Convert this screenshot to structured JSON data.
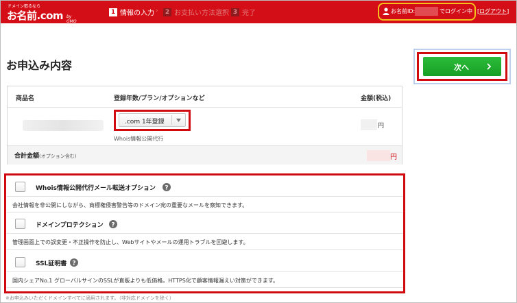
{
  "colors": {
    "header_red": "#d40e16",
    "accent_green": "#1fae2c",
    "highlight_red": "#d10a10",
    "login_highlight": "#f4c21b"
  },
  "header": {
    "logo_tagline": "ドメイン取るなら",
    "logo_main": "お名前.com",
    "logo_sub": "by GMO",
    "steps": [
      {
        "number": "1",
        "label": "情報の入力"
      },
      {
        "number": "2",
        "label": "お支払い方法選択"
      },
      {
        "number": "3",
        "label": "完了"
      }
    ],
    "login_label": "お名前ID:",
    "login_status": "でログイン中",
    "logout_open": "[",
    "logout_label": "ログアウト",
    "logout_close": "]"
  },
  "main": {
    "title": "お申込み内容",
    "next_button": {
      "label": "次へ",
      "icon": "chevron-right-icon"
    }
  },
  "table": {
    "headers": {
      "product": "商品名",
      "plan": "登録年数/プラン/オプションなど",
      "price": "金額(税込)"
    },
    "row": {
      "plan_selected": ".com 1年登録",
      "whois_note": "Whois情報公開代行",
      "price_unit": "円"
    },
    "total": {
      "label": "合計金額",
      "sub": "(オプション含む)",
      "unit": "円"
    }
  },
  "options": [
    {
      "title": "Whois情報公開代行メール転送オプション",
      "description": "会社情報を非公開にしながら、商標権侵害警告等のドメイン宛の重要なメールを察知できます。"
    },
    {
      "title": "ドメインプロテクション",
      "description": "管理画面上での誤変更・不正操作を防止し、Webサイトやメールの運用トラブルを回避します。"
    },
    {
      "title": "SSL証明書",
      "description": "国内シェアNo.1 グローバルサインのSSLが直販よりも低価格。HTTPS化で顧客情報漏えい対策ができます。"
    }
  ],
  "footnote": "※お申込みいただくドメインすべてに適用されます。（非対応ドメインを除く）"
}
